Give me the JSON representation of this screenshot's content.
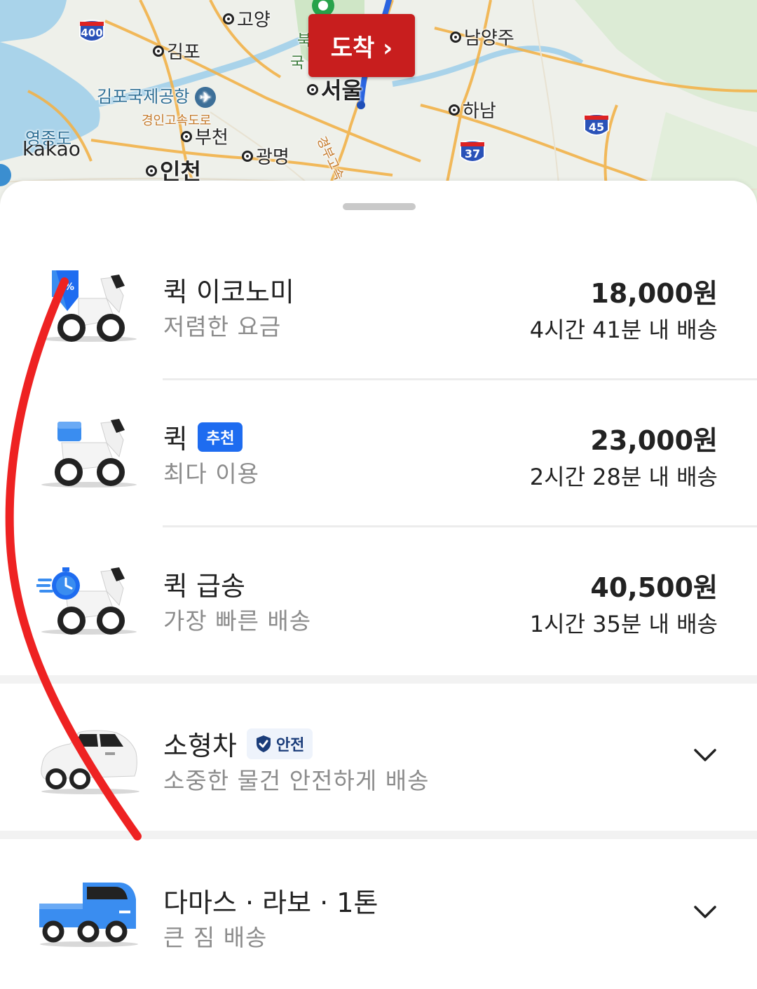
{
  "map": {
    "labels": {
      "goyang": "고양",
      "gimpo": "김포",
      "namyangju": "남양주",
      "gimpo_airport": "김포국제공항",
      "seoul": "서울",
      "hanam": "하남",
      "yeongjongdo": "영종도",
      "gyeongin_expressway": "경인고속도로",
      "bucheon": "부천",
      "gwangmyeong": "광명",
      "incheon": "인천",
      "gyeongbu": "경부고속",
      "buk": "북",
      "guk": "국"
    },
    "shields": {
      "s400": "400",
      "s45": "45",
      "s37": "37"
    },
    "provider": "kakao",
    "arrive_button": "도착 ›"
  },
  "options": [
    {
      "title": "퀵 이코노미",
      "subtitle": "저렴한 요금",
      "price": "18,000원",
      "eta": "4시간 41분 내 배송"
    },
    {
      "title": "퀵",
      "badge": "추천",
      "subtitle": "최다 이용",
      "price": "23,000원",
      "eta": "2시간 28분 내 배송"
    },
    {
      "title": "퀵 급송",
      "subtitle": "가장 빠른 배송",
      "price": "40,500원",
      "eta": "1시간 35분 내 배송"
    },
    {
      "title": "소형차",
      "badge": "안전",
      "subtitle": "소중한 물건 안전하게 배송"
    },
    {
      "title": "다마스 · 라보 · 1톤",
      "subtitle": "큰 짐 배송"
    }
  ],
  "colors": {
    "accent_blue": "#1e6cf0",
    "arrive_red": "#c81e1e",
    "annotation_red": "#ee2222"
  },
  "icons": [
    "discount-scooter-icon",
    "scooter-icon",
    "express-scooter-icon",
    "car-icon",
    "truck-icon",
    "chevron-down-icon",
    "shield-check-icon"
  ]
}
